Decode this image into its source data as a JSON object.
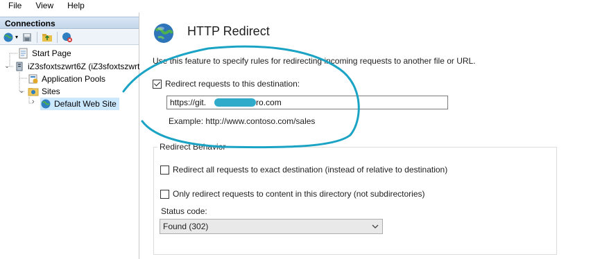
{
  "menu": [
    "File",
    "View",
    "Help"
  ],
  "connections": {
    "header": "Connections",
    "tree": {
      "start_page": "Start Page",
      "server": "iZ3sfoxtszwrt6Z (iZ3sfoxtszwrt",
      "app_pools": "Application Pools",
      "sites": "Sites",
      "default_site": "Default Web Site"
    }
  },
  "main": {
    "title": "HTTP Redirect",
    "description": "Use this feature to specify rules for redirecting incoming requests to another file or URL.",
    "redirect_checkbox_label": "Redirect requests to this destination:",
    "redirect_checked": true,
    "destination_value": "https://git.      ro.com",
    "example": "Example: http://www.contoso.com/sales",
    "behavior": {
      "legend": "Redirect Behavior",
      "exact_label": "Redirect all requests to exact destination (instead of relative to destination)",
      "exact_checked": false,
      "only_dir_label": "Only redirect requests to content in this directory (not subdirectories)",
      "only_dir_checked": false,
      "status_label": "Status code:",
      "status_value": "Found (302)"
    }
  },
  "colors": {
    "annotation": "#1aa3c4",
    "selection": "#cce8ff"
  }
}
